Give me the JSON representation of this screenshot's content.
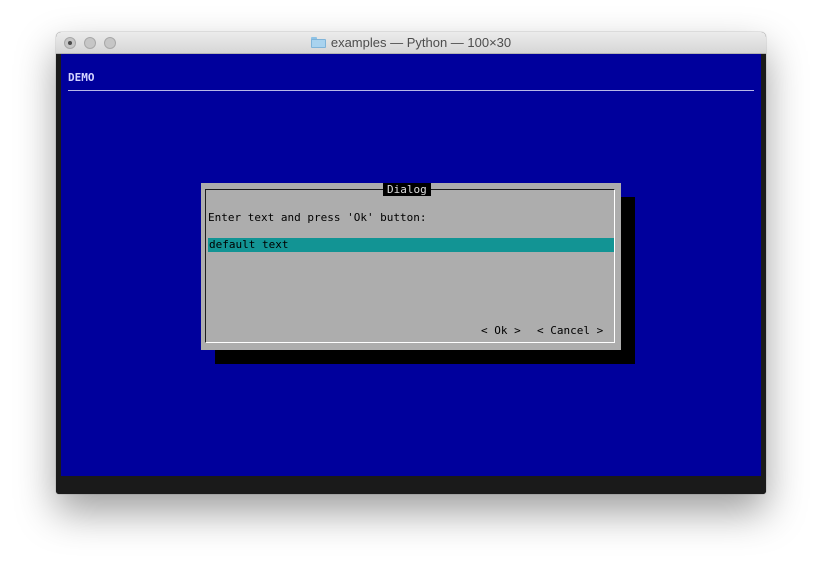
{
  "window": {
    "title": "examples — Python — 100×30",
    "title_icon": "folder-icon"
  },
  "terminal": {
    "background": "#00009c",
    "backtitle": "DEMO"
  },
  "dialog": {
    "title": "Dialog",
    "prompt": "Enter text and press 'Ok' button:",
    "input_value": "default text",
    "ok_label": "< Ok >",
    "cancel_label": "< Cancel >",
    "colors": {
      "dialog_bg": "#adadad",
      "input_bg": "#129494",
      "shadow": "#000000"
    }
  }
}
